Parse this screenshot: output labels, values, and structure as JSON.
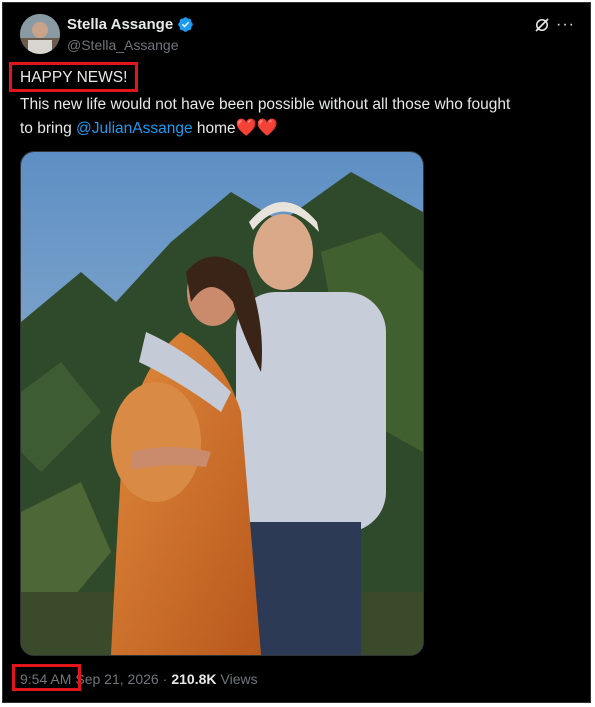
{
  "author": {
    "name": "Stella Assange",
    "handle": "@Stella_Assange",
    "verified_color": "#1d9bf0"
  },
  "tweet": {
    "headline": "HAPPY NEWS!",
    "line1": "This new life would not have been possible without all those who fought",
    "line2_prefix": "to bring ",
    "mention": "@JulianAssange",
    "line2_suffix": " home",
    "hearts": "❤️❤️"
  },
  "meta": {
    "time": "9:54 AM",
    "date": "Sep 21, 2026",
    "separator": "·",
    "views_count": "210.8K",
    "views_label": "Views"
  },
  "icons": [
    "grok-icon",
    "more-icon",
    "verified-badge-icon"
  ],
  "colors": {
    "accent": "#1d9bf0",
    "highlight": "#e2141c",
    "background": "#000000"
  }
}
